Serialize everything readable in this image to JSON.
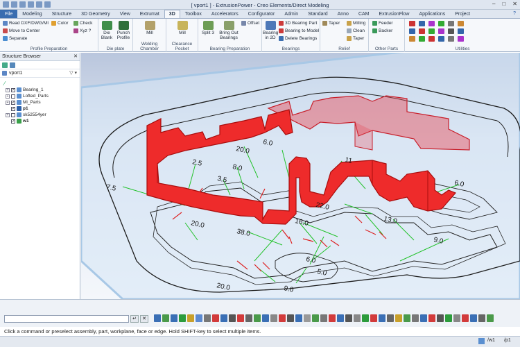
{
  "app": {
    "title": "[ vport1 ] - ExtrusionPower - Creo Elements/Direct Modeling",
    "window_controls": [
      "–",
      "□",
      "✕"
    ]
  },
  "tabs": [
    "File",
    "Modeling",
    "Structure",
    "3D Geometry",
    "View",
    "Extrumat",
    "3D",
    "Toolbox",
    "Accelerators",
    "Configurator",
    "Admin",
    "Standard",
    "Anno",
    "CAM",
    "ExtrusionFlow",
    "Applications",
    "Project"
  ],
  "active_tab": "3D",
  "ribbon": {
    "profile_prep": {
      "title": "Profile Preparation",
      "read": "Read DXF/DWG/MI",
      "move": "Move to Center",
      "separate": "Separate",
      "color": "Color",
      "check": "Check",
      "xyz": "Xyz ?"
    },
    "die_plate": {
      "title": "Die plate",
      "die_blank": "Die Blank",
      "punch": "Punch Profile"
    },
    "welding": {
      "title": "Welding Chamber",
      "mill": "Mill"
    },
    "clearance": {
      "title": "Clearance Pocket",
      "mill": "Mill"
    },
    "bearing_prep": {
      "title": "Bearing Preparation",
      "split": "Split 3",
      "bring_out": "Bring Out Bearings",
      "offset": "Offset"
    },
    "bearings": {
      "title": "Bearings",
      "bearing2d": "Bearing in 2D",
      "part3d": "3D Bearing Part",
      "to_model": "Bearing to Model",
      "delete": "Delete Bearings"
    },
    "relief": {
      "title": "Relief",
      "taper": "Taper",
      "milling": "Milling",
      "clean": "Clean",
      "taper2": "Taper"
    },
    "other": {
      "title": "Other Parts",
      "feeder": "Feeder",
      "backer": "Backer"
    },
    "utilities": {
      "title": "Utilities"
    }
  },
  "structure_browser": {
    "title": "Structure Browser",
    "view": "vport1",
    "items": [
      {
        "label": "Bearing_1",
        "checked": true,
        "bold": false
      },
      {
        "label": "Lofted_Parts",
        "checked": false,
        "bold": false
      },
      {
        "label": "Mi_Parts",
        "checked": true,
        "bold": false
      },
      {
        "label": "p1",
        "checked": true,
        "bold": true
      },
      {
        "label": "sk52554yer",
        "checked": false,
        "bold": false
      },
      {
        "label": "w1",
        "checked": true,
        "bold": true
      }
    ]
  },
  "viewport": {
    "dimensions": [
      "7.5",
      "2.5",
      "3.5",
      "8.0",
      "20.0",
      "6.0",
      "20.0",
      "11",
      "22.0",
      "6.0",
      "16.0",
      "13.0",
      "38.0",
      "9.0",
      "6.0",
      "5.0",
      "20.0",
      "9.0"
    ]
  },
  "command_line": {
    "value": ""
  },
  "status_text": "Click a command or preselect assembly, part, workplane, face or edge. Hold SHIFT-key to select multiple items.",
  "bottom_bar": {
    "wp": "/w1",
    "part": "/p1"
  }
}
